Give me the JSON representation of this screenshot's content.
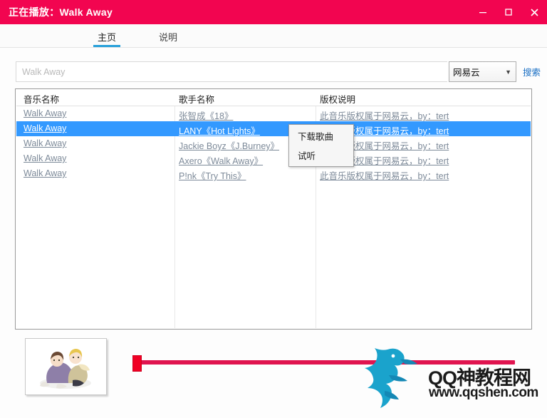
{
  "window": {
    "title": "正在播放：Walk Away",
    "accent_color": "#f20550",
    "minimize_label": "最小化",
    "maximize_label": "最大化",
    "close_label": "关闭"
  },
  "tabs": [
    {
      "label": "主页",
      "active": true
    },
    {
      "label": "说明",
      "active": false
    }
  ],
  "search": {
    "value": "",
    "placeholder": "Walk Away",
    "source": "网易云",
    "button_label": "搜索"
  },
  "table": {
    "columns": [
      "音乐名称",
      "歌手名称",
      "版权说明"
    ],
    "rows": [
      {
        "name": "Walk Away",
        "artist": "张智成《18》",
        "copyright": "此音乐版权属于网易云，by：tert",
        "selected": false
      },
      {
        "name": "Walk Away",
        "artist": "LANY《Hot Lights》",
        "copyright": "此音乐版权属于网易云，by：tert",
        "selected": true
      },
      {
        "name": "Walk Away",
        "artist": "Jackie Boyz《J.Burney》",
        "copyright": "此音乐版权属于网易云，by：tert",
        "selected": false
      },
      {
        "name": "Walk Away",
        "artist": "Axero《Walk Away》",
        "copyright": "此音乐版权属于网易云，by：tert",
        "selected": false
      },
      {
        "name": "Walk Away",
        "artist": "P!nk《Try This》",
        "copyright": "此音乐版权属于网易云，by：tert",
        "selected": false
      }
    ]
  },
  "context_menu": {
    "items": [
      "下载歌曲",
      "试听"
    ]
  },
  "player": {
    "progress_percent": 1,
    "selected_color": "#3399ff",
    "track_color": "#e0144f"
  },
  "watermark": {
    "title": "QQ神教程网",
    "url": "www.qqshen.com"
  }
}
